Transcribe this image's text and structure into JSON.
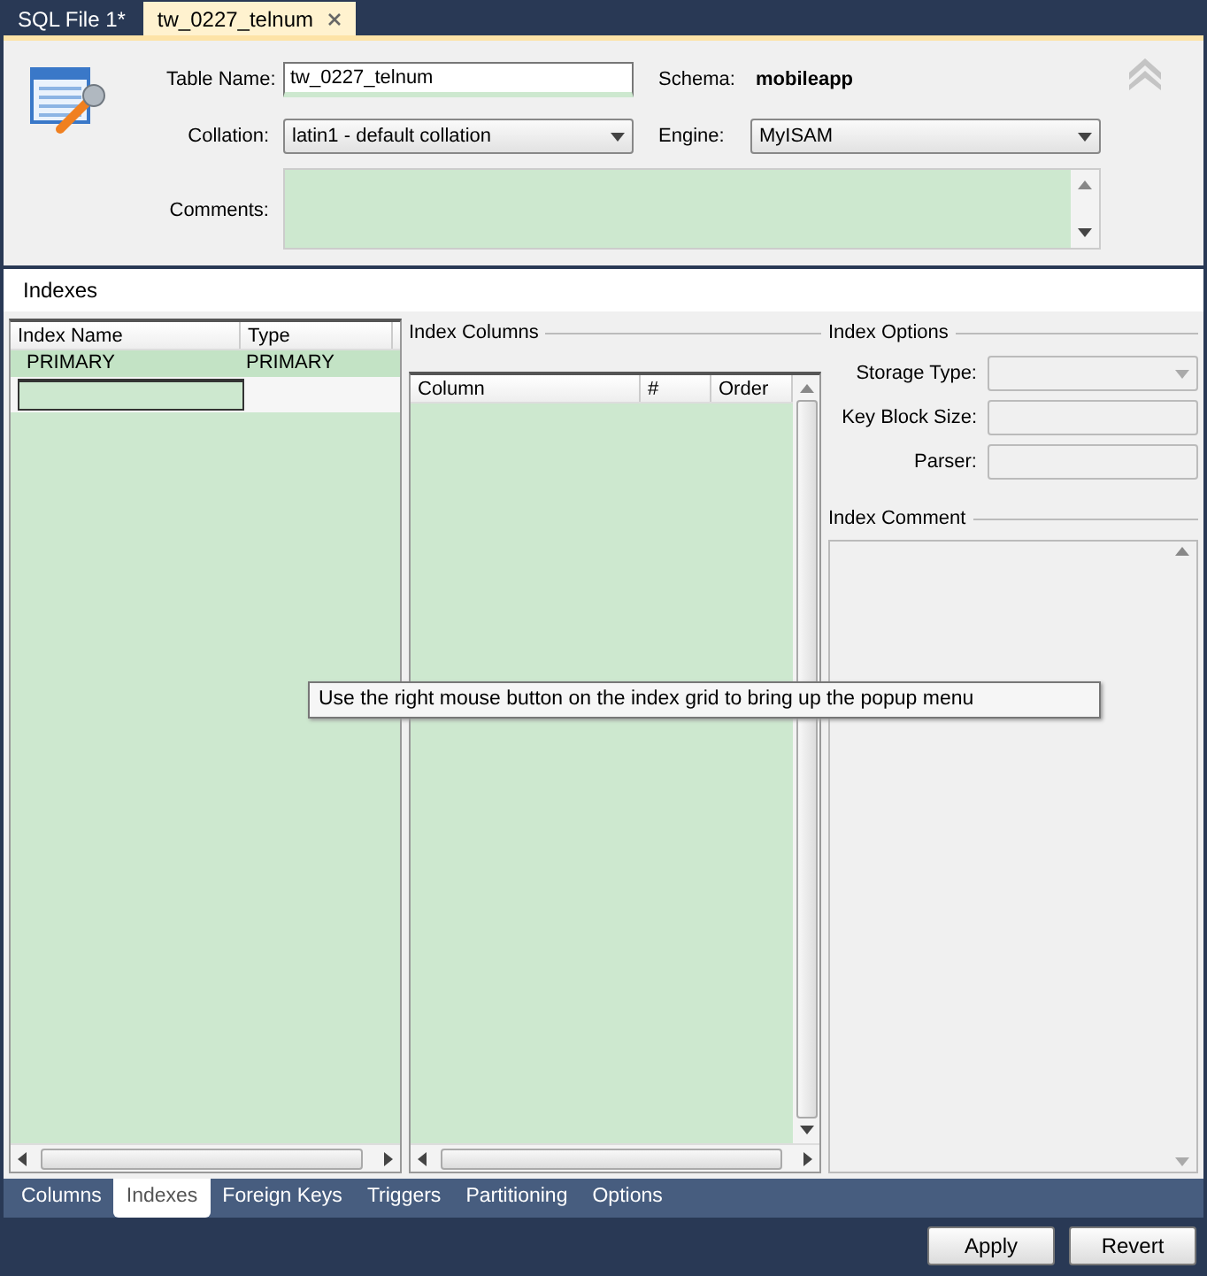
{
  "document_tabs": [
    {
      "label": "SQL File 1*",
      "selected": false,
      "closable": false
    },
    {
      "label": "tw_0227_telnum",
      "selected": true,
      "closable": true
    }
  ],
  "table_name": {
    "label": "Table Name:",
    "value": "tw_0227_telnum"
  },
  "schema": {
    "label": "Schema:",
    "value": "mobileapp"
  },
  "collation": {
    "label": "Collation:",
    "value": "latin1 - default collation"
  },
  "engine": {
    "label": "Engine:",
    "value": "MyISAM"
  },
  "comments": {
    "label": "Comments:"
  },
  "section_title": "Indexes",
  "index_grid": {
    "columns": [
      "Index Name",
      "Type"
    ],
    "rows": [
      {
        "cells": [
          "PRIMARY",
          "PRIMARY"
        ],
        "selected": true
      }
    ]
  },
  "index_columns": {
    "title": "Index Columns",
    "columns": [
      "Column",
      "#",
      "Order"
    ]
  },
  "index_options": {
    "title": "Index Options",
    "fields": [
      {
        "label": "Storage Type:",
        "kind": "select"
      },
      {
        "label": "Key Block Size:",
        "kind": "text"
      },
      {
        "label": "Parser:",
        "kind": "text"
      }
    ],
    "comment_title": "Index Comment"
  },
  "tooltip": "Use the right mouse button on the index grid to bring up the popup menu",
  "editor_tabs": [
    {
      "label": "Columns",
      "selected": false
    },
    {
      "label": "Indexes",
      "selected": true
    },
    {
      "label": "Foreign Keys",
      "selected": false
    },
    {
      "label": "Triggers",
      "selected": false
    },
    {
      "label": "Partitioning",
      "selected": false
    },
    {
      "label": "Options",
      "selected": false
    }
  ],
  "buttons": [
    "Apply",
    "Revert"
  ]
}
